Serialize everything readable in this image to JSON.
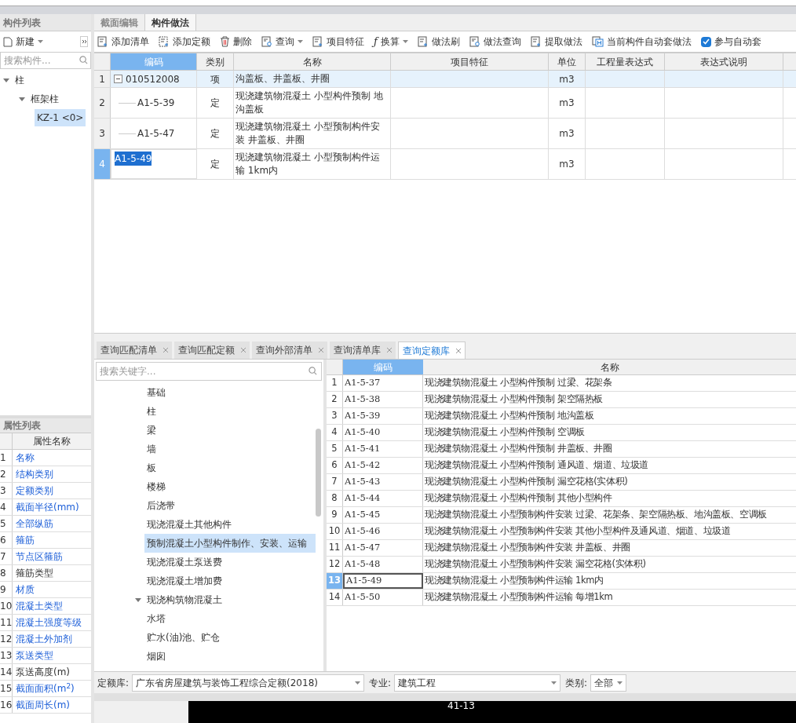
{
  "component_list": {
    "title": "构件列表",
    "new_button": "新建",
    "search": {
      "placeholder": "搜索构件..."
    },
    "tree": [
      {
        "label": "柱",
        "expanded": true,
        "selected": false,
        "children": [
          {
            "label": "框架柱",
            "expanded": true,
            "selected": false,
            "children": [
              {
                "label": "KZ-1 <0>",
                "selected": true
              }
            ]
          }
        ]
      }
    ]
  },
  "property_list": {
    "title": "属性列表",
    "column": "属性名称",
    "rows": [
      {
        "num": "1",
        "name": "名称",
        "linked": true
      },
      {
        "num": "2",
        "name": "结构类别",
        "linked": true
      },
      {
        "num": "3",
        "name": "定额类别",
        "linked": true
      },
      {
        "num": "4",
        "name": "截面半径(mm)",
        "linked": true
      },
      {
        "num": "5",
        "name": "全部纵筋",
        "linked": true
      },
      {
        "num": "6",
        "name": "箍筋",
        "linked": true
      },
      {
        "num": "7",
        "name": "节点区箍筋",
        "linked": true
      },
      {
        "num": "8",
        "name": "箍筋类型",
        "linked": false
      },
      {
        "num": "9",
        "name": "材质",
        "linked": true
      },
      {
        "num": "10",
        "name": "混凝土类型",
        "linked": true
      },
      {
        "num": "11",
        "name": "混凝土强度等级",
        "linked": true
      },
      {
        "num": "12",
        "name": "混凝土外加剂",
        "linked": true
      },
      {
        "num": "13",
        "name": "泵送类型",
        "linked": true
      },
      {
        "num": "14",
        "name": "泵送高度(m)",
        "linked": false
      },
      {
        "num": "15",
        "name": "截面面积(m$^{2}$)",
        "linked": true
      },
      {
        "num": "16",
        "name": "截面周长(m)",
        "linked": true
      }
    ]
  },
  "main_tabs": [
    {
      "label": "截面编辑",
      "selected": false
    },
    {
      "label": "构件做法",
      "selected": true
    }
  ],
  "toolbar": [
    {
      "label": "添加清单",
      "kind": "list",
      "dropdown": false
    },
    {
      "label": "添加定额",
      "kind": "quota",
      "dropdown": false
    },
    {
      "label": "删除",
      "kind": "delete",
      "dropdown": false
    },
    {
      "label": "查询",
      "kind": "query",
      "dropdown": true
    },
    {
      "label": "项目特征",
      "kind": "feature",
      "dropdown": false
    },
    {
      "label": "换算",
      "kind": "fx",
      "symbol": "ƒ",
      "dropdown": true
    },
    {
      "label": "做法刷",
      "kind": "brush",
      "dropdown": false
    },
    {
      "label": "做法查询",
      "kind": "query",
      "dropdown": false
    },
    {
      "label": "提取做法",
      "kind": "extract",
      "dropdown": false
    },
    {
      "label": "当前构件自动套做法",
      "kind": "auto",
      "dropdown": false
    }
  ],
  "auto_checkbox": {
    "label": "参与自动套",
    "checked": true
  },
  "method_table": {
    "columns": [
      "编码",
      "类别",
      "名称",
      "项目特征",
      "单位",
      "工程量表达式",
      "表达式说明"
    ],
    "rows": [
      {
        "num": "1",
        "code": "010512008",
        "type": "项",
        "name": "沟盖板、井盖板、井圈",
        "unit": "m3",
        "kind": "item",
        "selected": false,
        "editing": false
      },
      {
        "num": "2",
        "code": "A1-5-39",
        "type": "定",
        "name": "现浇建筑物混凝土 小型构件预制 地沟盖板",
        "unit": "m3",
        "kind": "quota",
        "selected": false,
        "editing": false
      },
      {
        "num": "3",
        "code": "A1-5-47",
        "type": "定",
        "name": "现浇建筑物混凝土 小型预制构件安装 井盖板、井圈",
        "unit": "m3",
        "kind": "quota",
        "selected": false,
        "editing": false
      },
      {
        "num": "4",
        "code": "A1-5-49",
        "type": "定",
        "name": "现浇建筑物混凝土 小型预制构件运输 1km内",
        "unit": "m3",
        "kind": "quota",
        "selected": true,
        "editing": true
      }
    ]
  },
  "query_tabs": [
    {
      "label": "查询匹配清单",
      "selected": false
    },
    {
      "label": "查询匹配定额",
      "selected": false
    },
    {
      "label": "查询外部清单",
      "selected": false
    },
    {
      "label": "查询清单库",
      "selected": false
    },
    {
      "label": "查询定额库",
      "selected": true
    }
  ],
  "query_search": {
    "placeholder": "搜索关键字..."
  },
  "chapter_tree": [
    {
      "label": "基础",
      "kind": "leaf",
      "selected": false
    },
    {
      "label": "柱",
      "kind": "leaf",
      "selected": false
    },
    {
      "label": "梁",
      "kind": "leaf",
      "selected": false
    },
    {
      "label": "墙",
      "kind": "leaf",
      "selected": false
    },
    {
      "label": "板",
      "kind": "leaf",
      "selected": false
    },
    {
      "label": "楼梯",
      "kind": "leaf",
      "selected": false
    },
    {
      "label": "后浇带",
      "kind": "leaf",
      "selected": false
    },
    {
      "label": "现浇混凝土其他构件",
      "kind": "leaf",
      "selected": false
    },
    {
      "label": "预制混凝土小型构件制作、安装、运输",
      "kind": "leaf",
      "selected": true
    },
    {
      "label": "现浇混凝土泵送费",
      "kind": "leaf",
      "selected": false
    },
    {
      "label": "现浇混凝土增加费",
      "kind": "leaf",
      "selected": false
    },
    {
      "label": "现浇构筑物混凝土",
      "kind": "group",
      "selected": false,
      "expanded": true,
      "children": [
        {
          "label": "水塔",
          "kind": "leaf",
          "selected": false
        },
        {
          "label": "贮水(油)池、贮仓",
          "kind": "leaf",
          "selected": false
        },
        {
          "label": "烟囱",
          "kind": "leaf",
          "selected": false
        }
      ]
    }
  ],
  "quota_table": {
    "columns": [
      "编码",
      "名称"
    ],
    "rows": [
      {
        "num": "1",
        "code": "A1-5-37",
        "name": "现浇建筑物混凝土 小型构件预制 过梁、花架条",
        "selected": false
      },
      {
        "num": "2",
        "code": "A1-5-38",
        "name": "现浇建筑物混凝土 小型构件预制 架空隔热板",
        "selected": false
      },
      {
        "num": "3",
        "code": "A1-5-39",
        "name": "现浇建筑物混凝土 小型构件预制 地沟盖板",
        "selected": false
      },
      {
        "num": "4",
        "code": "A1-5-40",
        "name": "现浇建筑物混凝土 小型构件预制 空调板",
        "selected": false
      },
      {
        "num": "5",
        "code": "A1-5-41",
        "name": "现浇建筑物混凝土 小型构件预制 井盖板、井圈",
        "selected": false
      },
      {
        "num": "6",
        "code": "A1-5-42",
        "name": "现浇建筑物混凝土 小型构件预制 通风道、烟道、垃圾道",
        "selected": false
      },
      {
        "num": "7",
        "code": "A1-5-43",
        "name": "现浇建筑物混凝土 小型构件预制 漏空花格(实体积)",
        "selected": false
      },
      {
        "num": "8",
        "code": "A1-5-44",
        "name": "现浇建筑物混凝土 小型构件预制 其他小型构件",
        "selected": false
      },
      {
        "num": "9",
        "code": "A1-5-45",
        "name": "现浇建筑物混凝土 小型预制构件安装 过梁、花架条、架空隔热板、地沟盖板、空调板",
        "selected": false
      },
      {
        "num": "10",
        "code": "A1-5-46",
        "name": "现浇建筑物混凝土 小型预制构件安装 其他小型构件及通风道、烟道、垃圾道",
        "selected": false
      },
      {
        "num": "11",
        "code": "A1-5-47",
        "name": "现浇建筑物混凝土 小型预制构件安装 井盖板、井圈",
        "selected": false
      },
      {
        "num": "12",
        "code": "A1-5-48",
        "name": "现浇建筑物混凝土 小型预制构件安装 漏空花格(实体积)",
        "selected": false
      },
      {
        "num": "13",
        "code": "A1-5-49",
        "name": "现浇建筑物混凝土 小型预制构件运输 1km内",
        "selected": true
      },
      {
        "num": "14",
        "code": "A1-5-50",
        "name": "现浇建筑物混凝土 小型预制构件运输 每增1km",
        "selected": false
      }
    ]
  },
  "filters": [
    {
      "label": "定额库:",
      "value": "广东省房屋建筑与装饰工程综合定额(2018)",
      "kind": "wide"
    },
    {
      "label": "专业:",
      "value": "建筑工程",
      "kind": "medium"
    },
    {
      "label": "类别:",
      "value": "全部",
      "kind": "small"
    }
  ],
  "canvas_strip": {
    "text": "41-13"
  }
}
